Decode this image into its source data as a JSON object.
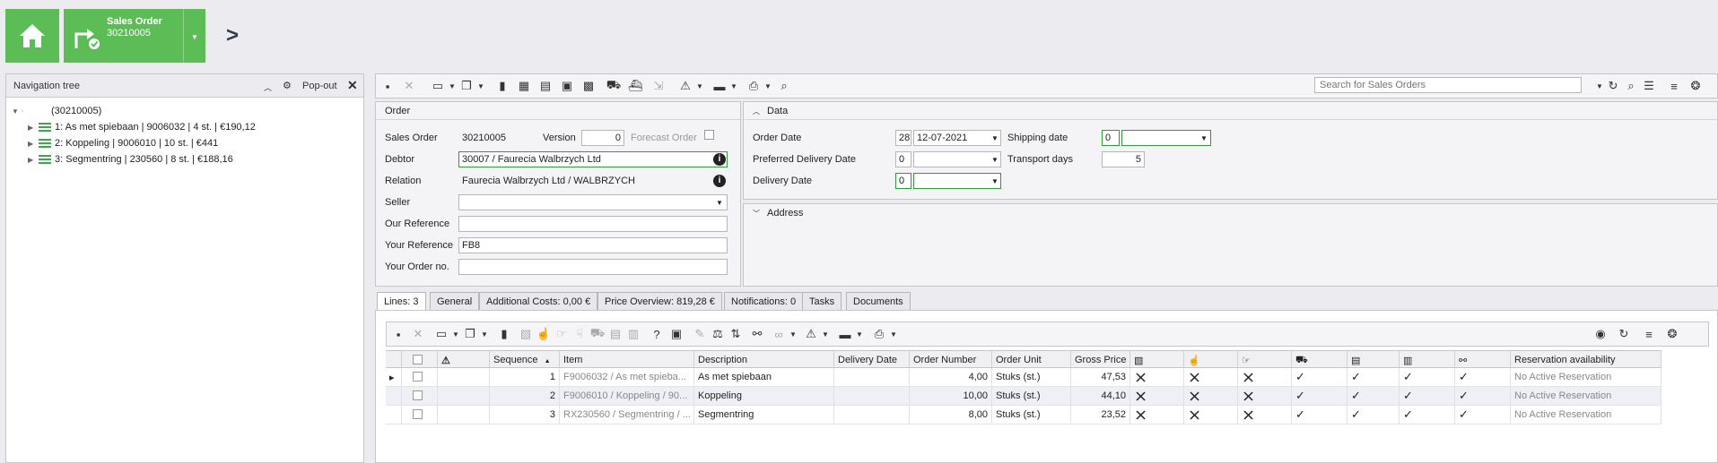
{
  "header": {
    "tile_title": "Sales Order",
    "tile_number": "30210005"
  },
  "nav": {
    "title": "Navigation tree",
    "popout": "Pop-out",
    "root": "(30210005)",
    "items": [
      {
        "label": "1: As met spiebaan | 9006032 | 4 st. | €190,12"
      },
      {
        "label": "2: Koppeling | 9006010 | 10 st. | €441"
      },
      {
        "label": "3: Segmentring | 230560 | 8 st. | €188,16"
      }
    ]
  },
  "search": {
    "placeholder": "Search for Sales Orders"
  },
  "order": {
    "title": "Order",
    "sales_order_label": "Sales Order",
    "sales_order_value": "30210005",
    "version_label": "Version",
    "version_value": "0",
    "forecast_label": "Forecast Order",
    "debtor_label": "Debtor",
    "debtor_value": "30007 / Faurecia Walbrzych Ltd",
    "relation_label": "Relation",
    "relation_value": "Faurecia Walbrzych Ltd / WALBRZYCH",
    "seller_label": "Seller",
    "seller_value": "",
    "our_ref_label": "Our Reference",
    "our_ref_value": "",
    "your_ref_label": "Your Reference",
    "your_ref_value": "FB8",
    "your_order_label": "Your Order no.",
    "your_order_value": ""
  },
  "data_panel": {
    "title": "Data",
    "order_date_label": "Order Date",
    "order_date_day": "28",
    "order_date_value": "12-07-2021",
    "preferred_label": "Preferred Delivery Date",
    "preferred_value": "0",
    "delivery_label": "Delivery Date",
    "delivery_value": "0",
    "shipping_label": "Shipping date",
    "shipping_value": "0",
    "transport_label": "Transport days",
    "transport_value": "5"
  },
  "address": {
    "title": "Address"
  },
  "tabs": [
    {
      "label": "Lines: 3"
    },
    {
      "label": "General"
    },
    {
      "label": "Additional Costs: 0,00 €"
    },
    {
      "label": "Price Overview: 819,28 €"
    },
    {
      "label": "Notifications: 0"
    },
    {
      "label": "Tasks"
    },
    {
      "label": "Documents"
    }
  ],
  "grid": {
    "columns": {
      "sequence": "Sequence",
      "item": "Item",
      "description": "Description",
      "delivery_date": "Delivery Date",
      "order_number": "Order Number",
      "order_unit": "Order Unit",
      "gross_price": "Gross Price",
      "reservation": "Reservation availability"
    },
    "rows": [
      {
        "seq": "1",
        "item": "F9006032 / As met spieba...",
        "desc": "As met spiebaan",
        "delivery": "",
        "qty": "4,00",
        "unit": "Stuks (st.)",
        "price": "47,53",
        "reservation": "No Active Reservation"
      },
      {
        "seq": "2",
        "item": "F9006010 / Koppeling / 90...",
        "desc": "Koppeling",
        "delivery": "",
        "qty": "10,00",
        "unit": "Stuks (st.)",
        "price": "44,10",
        "reservation": "No Active Reservation"
      },
      {
        "seq": "3",
        "item": "RX230560 / Segmentring / ...",
        "desc": "Segmentring",
        "delivery": "",
        "qty": "8,00",
        "unit": "Stuks (st.)",
        "price": "23,52",
        "reservation": "No Active Reservation"
      }
    ]
  },
  "colors": {
    "accent_green": "#5cbd56",
    "field_green_border": "#2e9a3a",
    "popout_link": "#1a5aa8"
  }
}
